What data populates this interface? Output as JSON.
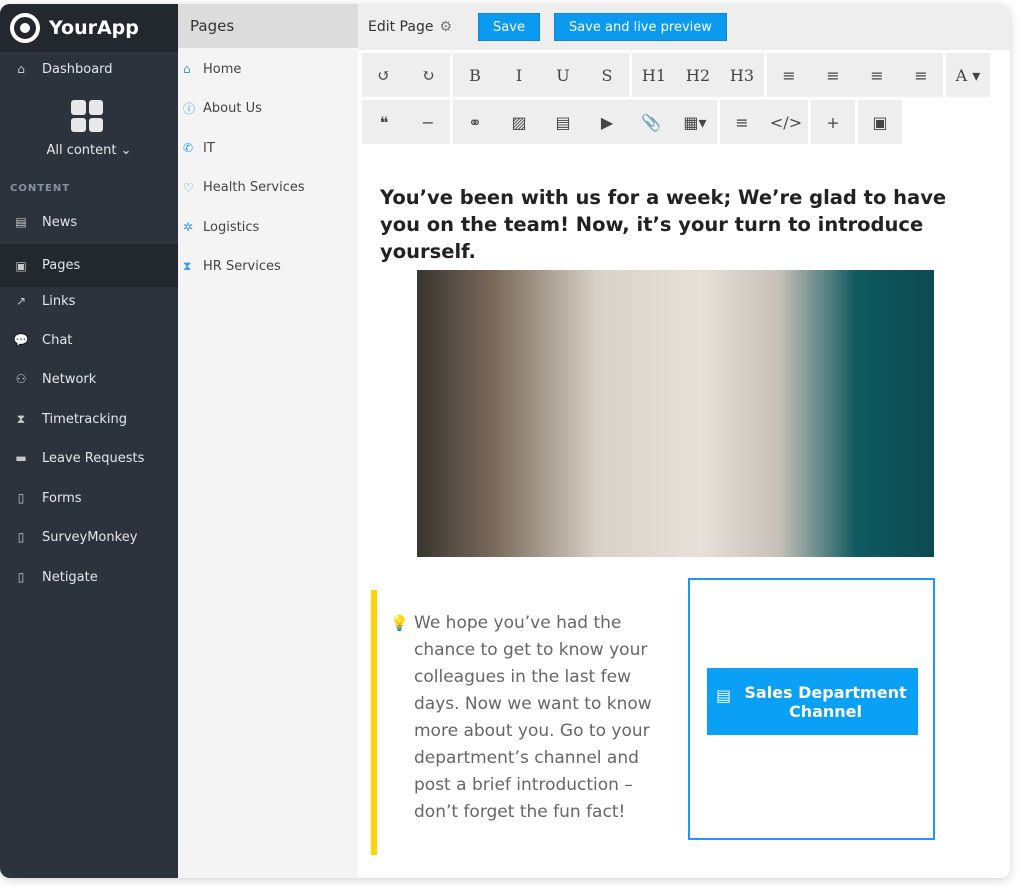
{
  "app": {
    "name": "YourApp"
  },
  "sidebar": {
    "dashboard": {
      "label": "Dashboard",
      "icon": "⌂"
    },
    "all_content": "All content",
    "section": "CONTENT",
    "items": [
      {
        "label": "News",
        "icon": "▤"
      },
      {
        "label": "Pages",
        "icon": "▣",
        "active": true
      },
      {
        "label": "Links",
        "icon": "↗"
      },
      {
        "label": "Chat",
        "icon": "💬"
      },
      {
        "label": "Network",
        "icon": "⚇"
      },
      {
        "label": "Timetracking",
        "icon": "⧗"
      },
      {
        "label": "Leave Requests",
        "icon": "▬"
      },
      {
        "label": "Forms",
        "icon": "▯"
      },
      {
        "label": "SurveyMonkey",
        "icon": "▯"
      },
      {
        "label": "Netigate",
        "icon": "▯"
      }
    ]
  },
  "pages": {
    "title": "Pages",
    "items": [
      {
        "label": "Home",
        "icon": "⌂"
      },
      {
        "label": "About Us",
        "icon": "ⓘ"
      },
      {
        "label": "IT",
        "icon": "✆"
      },
      {
        "label": "Health Services",
        "icon": "♡"
      },
      {
        "label": "Logistics",
        "icon": "✲"
      },
      {
        "label": "HR Services",
        "icon": "⧗"
      }
    ]
  },
  "editor": {
    "title": "Edit Page",
    "gear": "⚙",
    "save": "Save",
    "save_preview": "Save and live preview",
    "toolbar_row1": [
      [
        "↺",
        "↻"
      ],
      [
        "B",
        "I",
        "U",
        "S"
      ],
      [
        "H1",
        "H2",
        "H3"
      ],
      [
        "≡",
        "≡",
        "≡",
        "≡"
      ],
      [
        "A ▾"
      ]
    ],
    "toolbar_row2": [
      [
        "❝",
        "−"
      ],
      [
        "⚭",
        "▨",
        "▤",
        "▶",
        "📎",
        "▦▾"
      ],
      [
        "≡",
        "</>"
      ],
      [
        "+"
      ],
      [
        "▣"
      ]
    ]
  },
  "content": {
    "headline": "You’ve been with us for a week; We’re glad to have you on the team! Now, it’s your turn to introduce yourself.",
    "quote": "We hope you’ve had the chance to get to know your colleagues in the last few days. Now we want to know more about you. Go to your department’s channel and post a brief introduction – don’t forget the fun fact!",
    "channel_button": "Sales Department Channel",
    "channel_icon": "inbox-icon"
  },
  "colors": {
    "accent": "#0a9bf0",
    "quote_bar": "#ffd400",
    "sidebar": "#2d333d"
  }
}
